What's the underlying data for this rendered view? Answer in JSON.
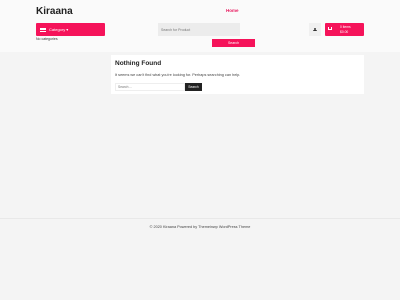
{
  "site": {
    "title": "Kiraana"
  },
  "nav": {
    "home": "Home"
  },
  "header": {
    "category_label": "Category",
    "category_chevron": "▾",
    "no_categories": "No categories",
    "search_placeholder": "Search for Product",
    "search_button": "Search",
    "cart_items": "0 items",
    "cart_total": "$0.00"
  },
  "main": {
    "title": "Nothing Found",
    "message": "It seems we can't find what you're looking for. Perhaps searching can help.",
    "search_placeholder": "Search ...",
    "search_button": "Search"
  },
  "footer": {
    "text": "© 2020 Kiraana Powered by Themeinwp WordPress Theme"
  },
  "colors": {
    "accent": "#f5135a",
    "nav_active": "#e8175d",
    "dark_button": "#222222"
  }
}
